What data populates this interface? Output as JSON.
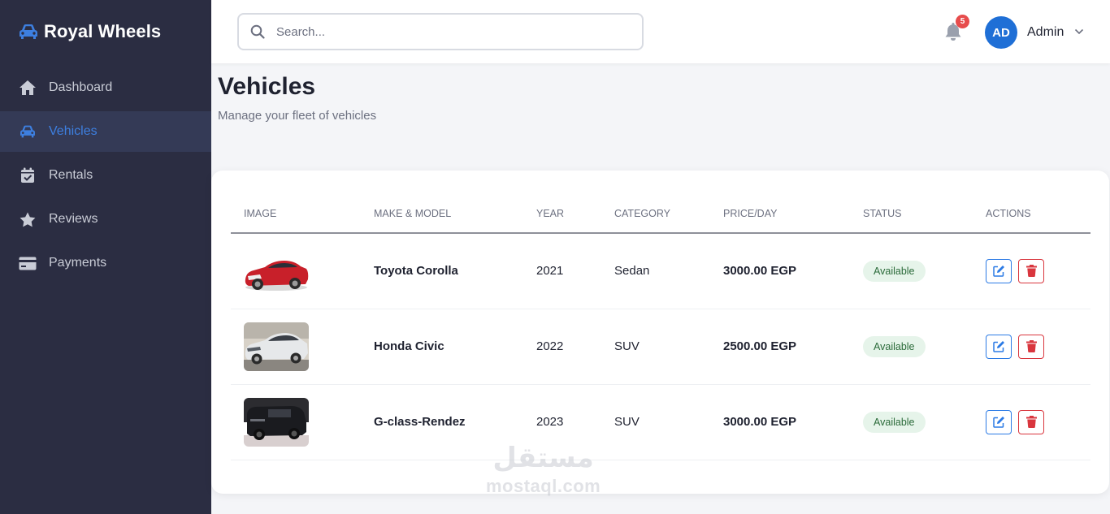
{
  "brand": {
    "name": "Royal Wheels",
    "icon": "car-icon",
    "accent": "#3d7fe0"
  },
  "sidebar": {
    "items": [
      {
        "label": "Dashboard",
        "icon": "home-icon",
        "active": false
      },
      {
        "label": "Vehicles",
        "icon": "car-icon",
        "active": true
      },
      {
        "label": "Rentals",
        "icon": "calendar-check-icon",
        "active": false
      },
      {
        "label": "Reviews",
        "icon": "star-icon",
        "active": false
      },
      {
        "label": "Payments",
        "icon": "credit-card-icon",
        "active": false
      }
    ]
  },
  "topbar": {
    "search_placeholder": "Search...",
    "notifications_count": "5",
    "avatar_initials": "AD",
    "user_name": "Admin"
  },
  "page": {
    "title": "Vehicles",
    "subtitle": "Manage your fleet of vehicles"
  },
  "table": {
    "headers": [
      "IMAGE",
      "MAKE & MODEL",
      "YEAR",
      "CATEGORY",
      "PRICE/DAY",
      "STATUS",
      "ACTIONS"
    ],
    "rows": [
      {
        "model": "Toyota Corolla",
        "year": "2021",
        "category": "Sedan",
        "price": "3000.00 EGP",
        "status": "Available"
      },
      {
        "model": "Honda Civic",
        "year": "2022",
        "category": "SUV",
        "price": "2500.00 EGP",
        "status": "Available"
      },
      {
        "model": "G-class-Rendez",
        "year": "2023",
        "category": "SUV",
        "price": "3000.00 EGP",
        "status": "Available"
      }
    ]
  },
  "watermark": {
    "arabic": "مستقل",
    "latin": "mostaql.com"
  },
  "colors": {
    "sidebar_bg": "#2b2d42",
    "primary": "#1f6fd6",
    "danger": "#d9363e",
    "status_bg": "#e6f4ea"
  }
}
